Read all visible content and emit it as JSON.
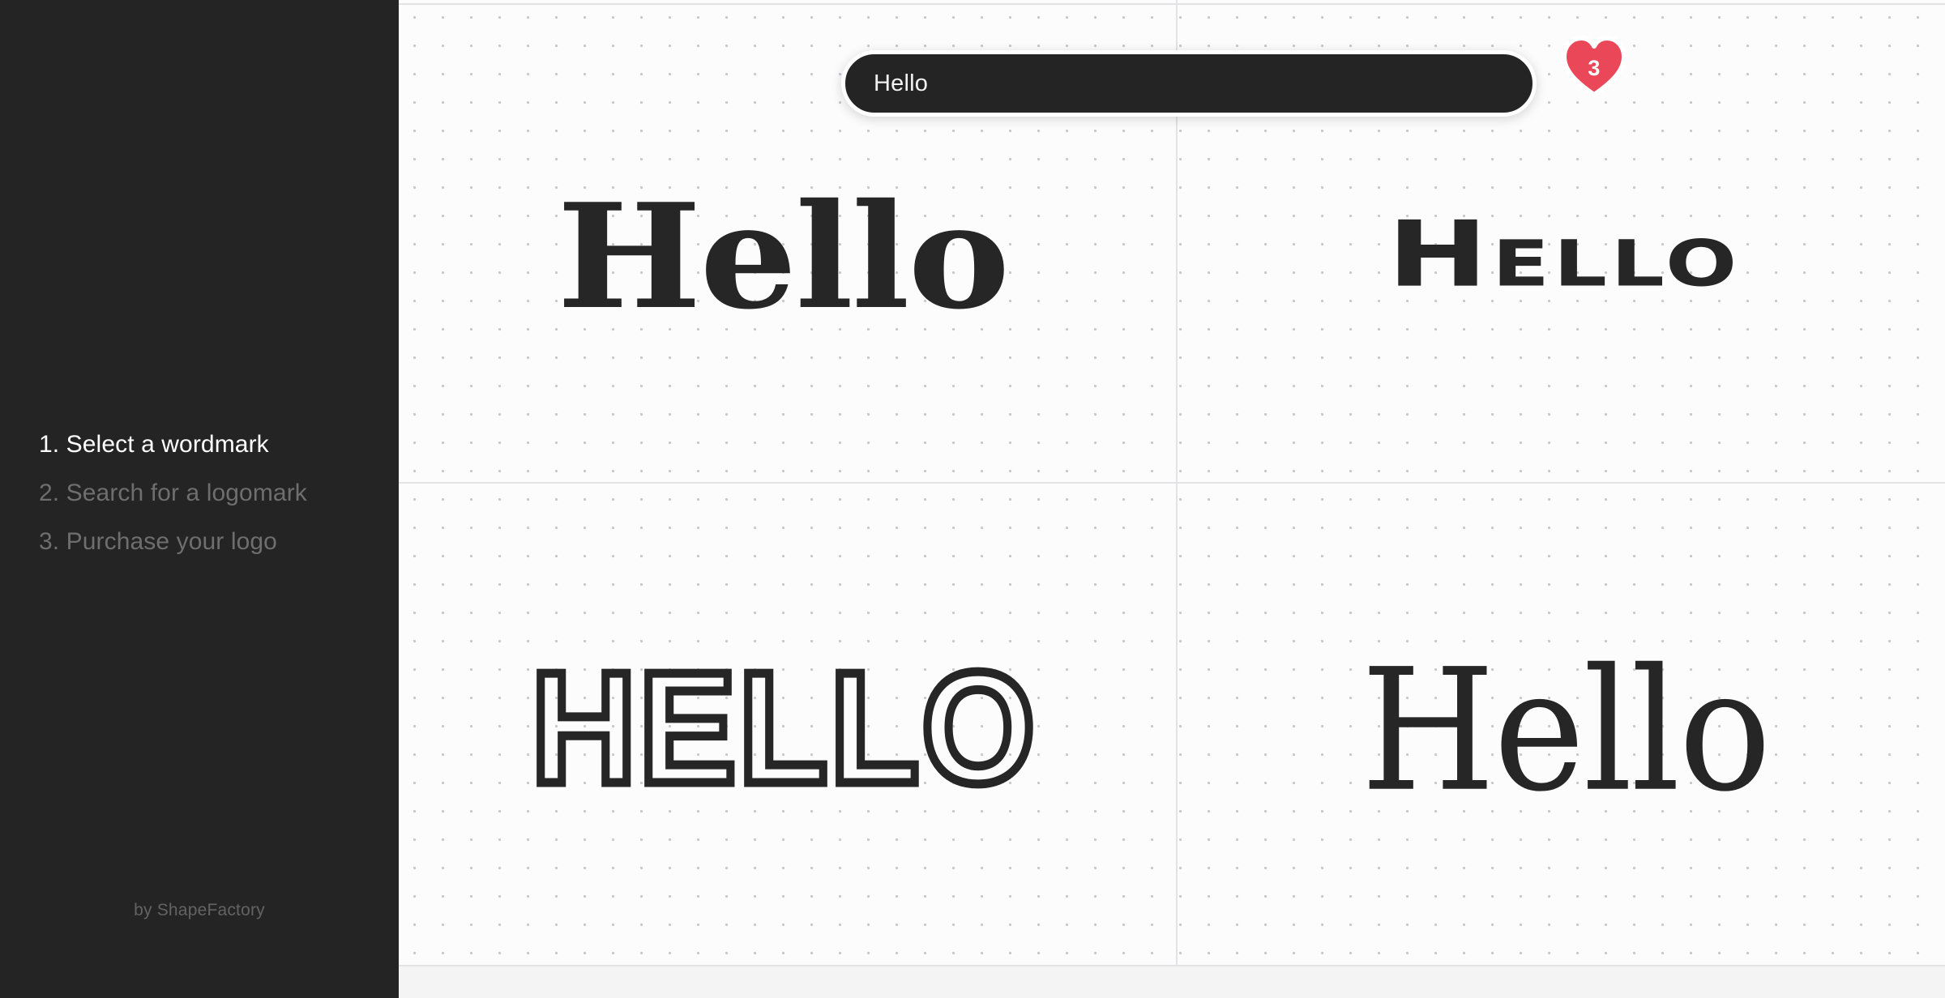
{
  "sidebar": {
    "steps": [
      {
        "label": "1. Select a wordmark",
        "state": "active"
      },
      {
        "label": "2. Search for a logomark",
        "state": "inactive"
      },
      {
        "label": "3. Purchase your logo",
        "state": "inactive"
      }
    ],
    "footer": "by ShapeFactory",
    "background_color": "#242424"
  },
  "search": {
    "value": "Hello",
    "placeholder": "Enter your brand name"
  },
  "favorites": {
    "icon": "heart-icon",
    "count": "3",
    "color": "#ea4758"
  },
  "canvas": {
    "background_color": "#fcfcfc",
    "dot_color": "#c9c9cd",
    "rule_color": "#e3e3e5",
    "ink_color": "#262626"
  },
  "wordmarks": [
    {
      "text": "Hello",
      "style": "wm-slab",
      "font_style_name": "heavy-slab-serif"
    },
    {
      "text": "Hello",
      "style": "wm-unicase",
      "font_style_name": "geometric-unicase-sans"
    },
    {
      "text": "HELLO",
      "style": "wm-outline",
      "font_style_name": "outlined-condensed-uppercase"
    },
    {
      "text": "Hello",
      "style": "wm-didone",
      "font_style_name": "high-contrast-didone-serif"
    }
  ]
}
